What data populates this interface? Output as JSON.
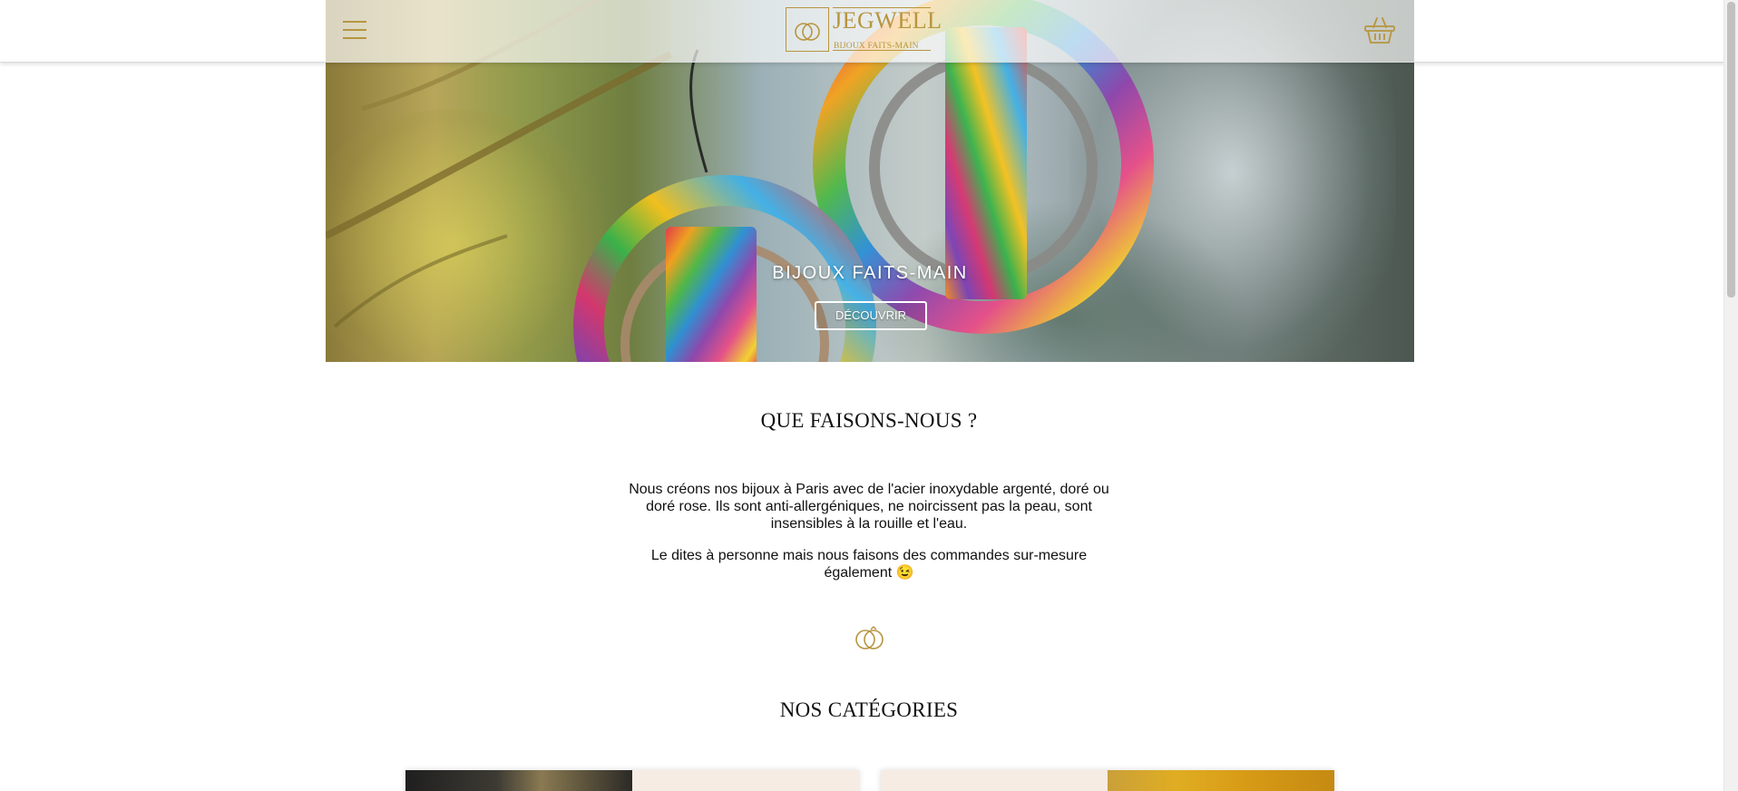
{
  "header": {
    "logo_name": "JEGWELL",
    "logo_tagline": "BIJOUX FAITS-MAIN",
    "menu_icon": "hamburger-menu-icon",
    "cart_icon": "basket-icon",
    "accent_color": "#b7953f"
  },
  "hero": {
    "title": "BIJOUX FAITS-MAIN",
    "button_label": "DÉCOUVRIR"
  },
  "about": {
    "title": "QUE FAISONS-NOUS ?",
    "paragraph_1": "Nous créons nos bijoux à Paris avec de l'acier inoxydable argenté, doré ou doré rose. Ils sont anti-allergéniques, ne noircissent pas la peau, sont insensibles à la rouille et l'eau.",
    "paragraph_2": "Le dites à personne mais nous faisons des commandes sur-mesure également 😉",
    "divider_icon": "rings-icon"
  },
  "categories": {
    "title": "NOS CATÉGORIES"
  }
}
